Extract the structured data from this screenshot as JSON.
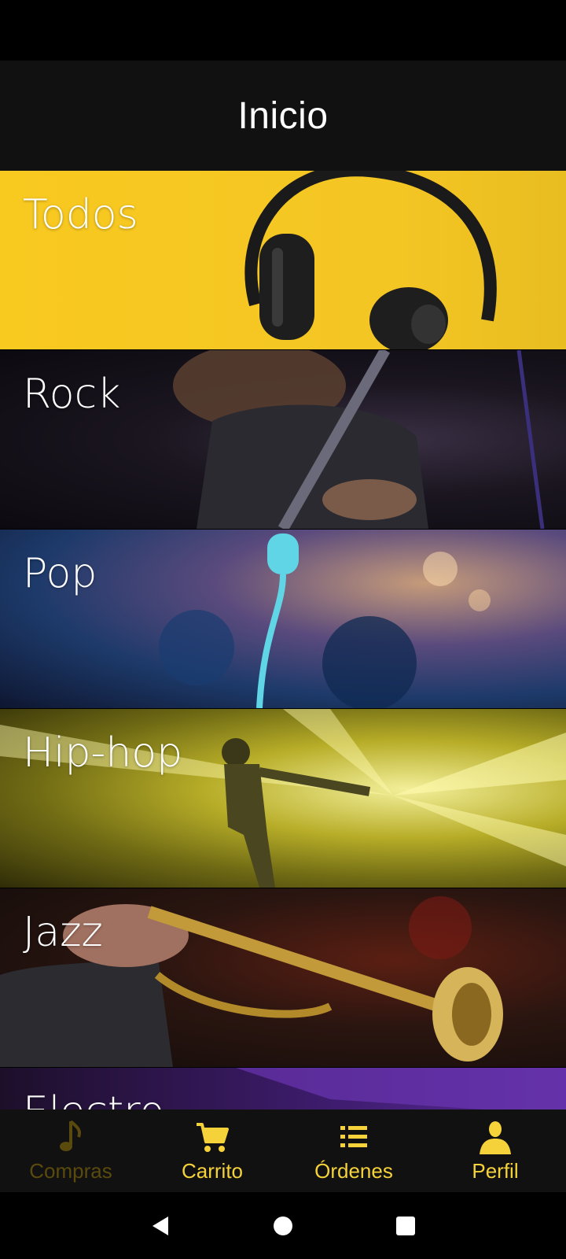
{
  "app_bar": {
    "title": "Inicio"
  },
  "categories": [
    {
      "label": "Todos"
    },
    {
      "label": "Rock"
    },
    {
      "label": "Pop"
    },
    {
      "label": "Hip-hop"
    },
    {
      "label": "Jazz"
    },
    {
      "label": "Electro"
    }
  ],
  "bottom_nav": {
    "items": [
      {
        "label": "Compras",
        "icon": "music-note-icon",
        "active": false
      },
      {
        "label": "Carrito",
        "icon": "cart-icon",
        "active": true
      },
      {
        "label": "Órdenes",
        "icon": "list-icon",
        "active": true
      },
      {
        "label": "Perfil",
        "icon": "person-icon",
        "active": true
      }
    ],
    "active_color": "#f6d23a",
    "inactive_color": "#5a4a0e"
  },
  "colors": {
    "app_bar_bg": "#111111",
    "todos_bg": "#f8c91f"
  }
}
